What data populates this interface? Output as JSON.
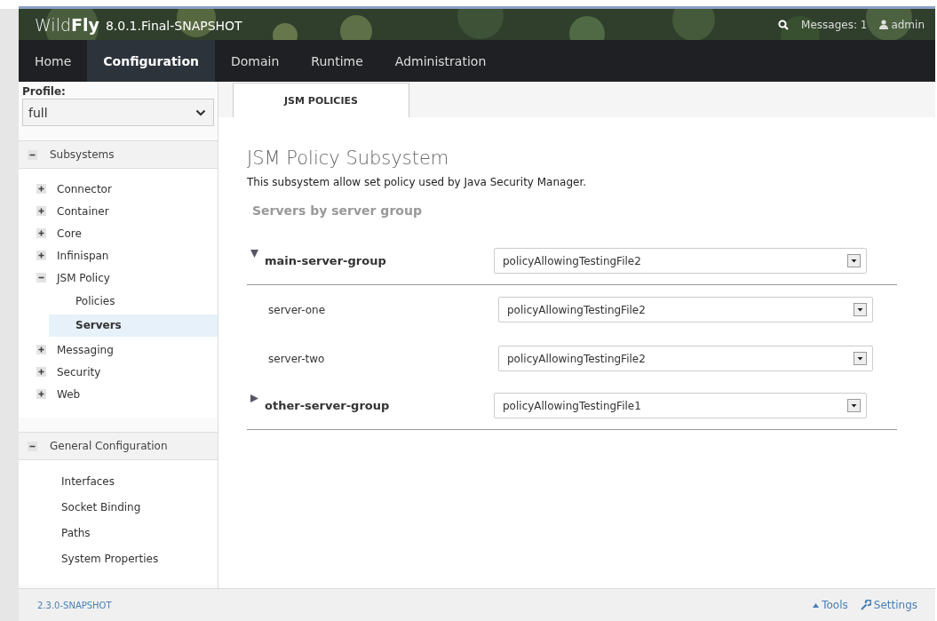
{
  "header": {
    "brand": "Wild**Fly**",
    "version": "8.0.1.Final-SNAPSHOT",
    "messages": "Messages: 1",
    "user": "admin"
  },
  "nav": [
    {
      "label": "Home",
      "selected": false
    },
    {
      "label": "Configuration",
      "selected": true
    },
    {
      "label": "Domain",
      "selected": false
    },
    {
      "label": "Runtime",
      "selected": false
    },
    {
      "label": "Administration",
      "selected": false
    }
  ],
  "sidebar": {
    "profile_label": "Profile:",
    "profile": "full",
    "sections": [
      {
        "title": "Subsystems",
        "expanded": true,
        "items": [
          {
            "kind": "node",
            "label": "Connector",
            "expanded": false
          },
          {
            "kind": "node",
            "label": "Container",
            "expanded": false
          },
          {
            "kind": "node",
            "label": "Core",
            "expanded": false
          },
          {
            "kind": "node",
            "label": "Infinispan",
            "expanded": false
          },
          {
            "kind": "node",
            "label": "JSM Policy",
            "expanded": true,
            "children": [
              {
                "label": "Policies",
                "selected": false
              },
              {
                "label": "Servers",
                "selected": true
              }
            ]
          },
          {
            "kind": "node",
            "label": "Messaging",
            "expanded": false
          },
          {
            "kind": "node",
            "label": "Security",
            "expanded": false
          },
          {
            "kind": "node",
            "label": "Web",
            "expanded": false
          }
        ]
      },
      {
        "title": "General Configuration",
        "expanded": true,
        "items": [
          {
            "kind": "leaf",
            "label": "Interfaces"
          },
          {
            "kind": "leaf",
            "label": "Socket Binding"
          },
          {
            "kind": "leaf",
            "label": "Paths"
          },
          {
            "kind": "leaf",
            "label": "System Properties"
          }
        ]
      }
    ]
  },
  "tabs": [
    {
      "label": "JSM POLICIES",
      "selected": true
    }
  ],
  "content": {
    "title": "JSM Policy Subsystem",
    "description": "This subsystem allow set policy used by Java Security Manager.",
    "subtitle": "Servers by server group",
    "groups": [
      {
        "name": "main-server-group",
        "expanded": true,
        "policy": "policyAllowingTestingFile2",
        "servers": [
          {
            "name": "server-one",
            "policy": "policyAllowingTestingFile2"
          },
          {
            "name": "server-two",
            "policy": "policyAllowingTestingFile2"
          }
        ]
      },
      {
        "name": "other-server-group",
        "expanded": false,
        "policy": "policyAllowingTestingFile1"
      }
    ]
  },
  "footer": {
    "version": "2.3.0-SNAPSHOT",
    "tools": "Tools",
    "settings": "Settings"
  }
}
